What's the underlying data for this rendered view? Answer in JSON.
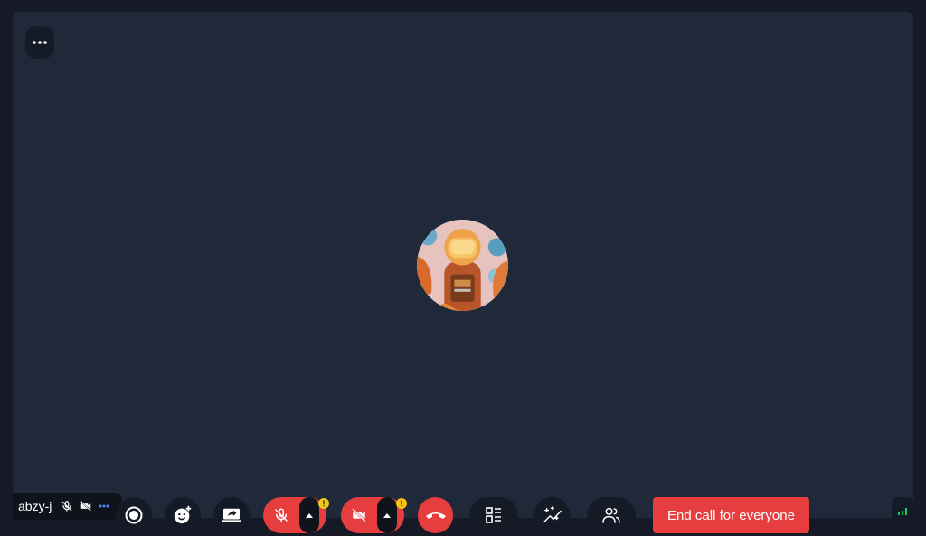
{
  "participant": {
    "name": "abzy-j",
    "mic_icon": "mic-off-icon",
    "camera_icon": "camera-off-icon",
    "options_icon": "ellipsis-icon"
  },
  "stage": {
    "menu_icon": "ellipsis-icon",
    "avatar_icon": "astronaut-avatar"
  },
  "toolbar": {
    "record_icon": "record-icon",
    "reactions_icon": "emoji-add-icon",
    "share_icon": "screen-share-icon",
    "mic_icon": "mic-off-icon",
    "mic_warning": "!",
    "camera_icon": "camera-off-icon",
    "camera_warning": "!",
    "hangup_icon": "phone-hangup-icon",
    "layout_icon": "layout-icon",
    "effects_icon": "sparkles-icon",
    "participants_icon": "people-icon",
    "end_call_label": "End call for everyone"
  },
  "colors": {
    "background": "#151a26",
    "stage": "#1f2939",
    "danger": "#e63e3e",
    "warning": "#f5c518",
    "network_good": "#22c55e"
  }
}
